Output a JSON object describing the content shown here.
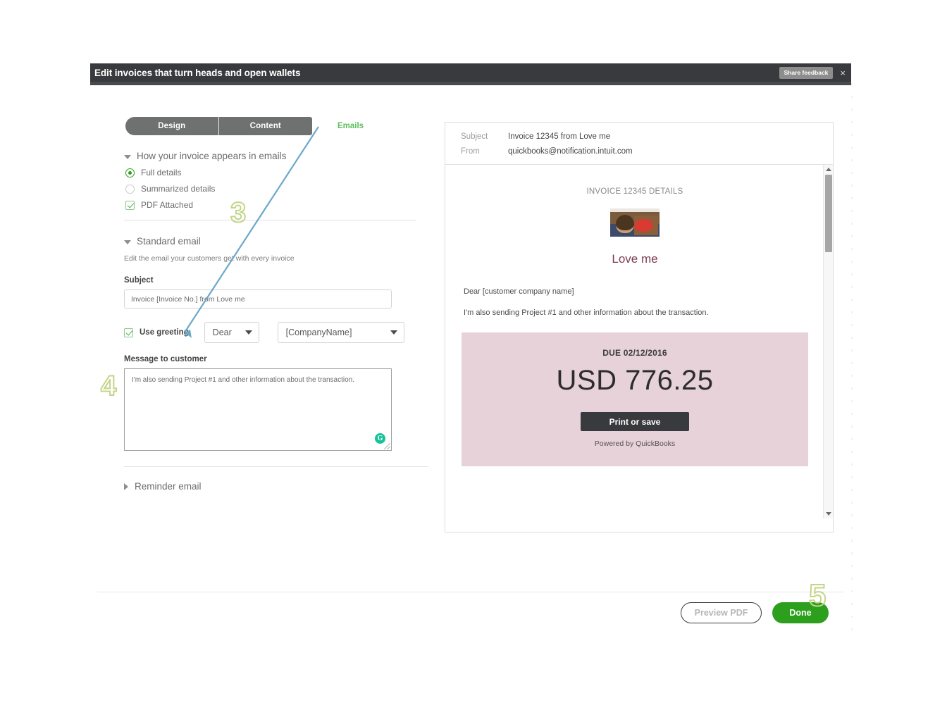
{
  "titlebar": {
    "title": "Edit invoices that turn heads and open wallets",
    "share_feedback": "Share feedback",
    "close": "×"
  },
  "tabs": [
    {
      "label": "Design",
      "active": false
    },
    {
      "label": "Content",
      "active": false
    },
    {
      "label": "Emails",
      "active": true
    }
  ],
  "appearance": {
    "section_title": "How your invoice appears in emails",
    "options": [
      {
        "label": "Full details",
        "selected": true
      },
      {
        "label": "Summarized details",
        "selected": false
      }
    ],
    "pdf_attached": {
      "label": "PDF Attached",
      "checked": true
    }
  },
  "standard_email": {
    "section_title": "Standard email",
    "note": "Edit the email your customers get with every invoice",
    "subject_label": "Subject",
    "subject_value": "Invoice [Invoice No.] from Love me",
    "use_greeting_label": "Use greeting",
    "use_greeting_checked": true,
    "greeting_select": "Dear",
    "name_select": "[CompanyName]",
    "message_label": "Message to customer",
    "message_value": "I'm also sending Project #1 and other information about the transaction.",
    "grammarly_glyph": "G"
  },
  "reminder_email": {
    "section_title": "Reminder email"
  },
  "preview": {
    "subject_key": "Subject",
    "subject_value": "Invoice 12345 from Love me",
    "from_key": "From",
    "from_value": "quickbooks@notification.intuit.com",
    "invoice_details_title": "INVOICE 12345 DETAILS",
    "business_name": "Love me",
    "greeting_line": "Dear [customer company name]",
    "message_line": "I'm also sending Project #1 and other information about the transaction.",
    "due_label": "DUE 02/12/2016",
    "amount": "USD 776.25",
    "print_button": "Print or save",
    "powered_by": "Powered by QuickBooks"
  },
  "footer": {
    "preview_pdf": "Preview PDF",
    "done": "Done"
  },
  "annotations": {
    "step3": "3",
    "step4": "4",
    "step5": "5"
  },
  "colors": {
    "titlebar": "#393a3d",
    "accent_green": "#2ca01c",
    "tab_gray": "#6f7070",
    "due_panel_pink": "#e6d2d8",
    "business_name": "#7c3b4e",
    "annotation_green": "#c3d58a",
    "arrow_blue": "#6aa9c9"
  }
}
